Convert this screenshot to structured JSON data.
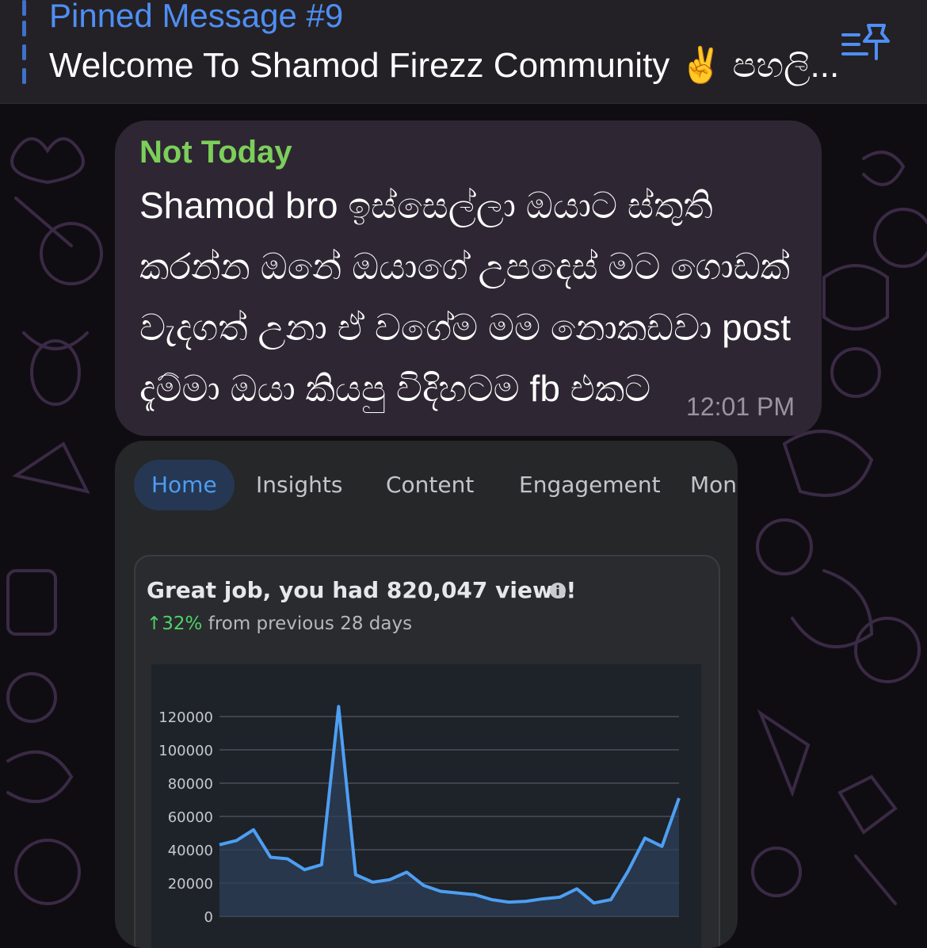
{
  "pinned": {
    "title": "Pinned Message #9",
    "text": "Welcome To Shamod Firezz Community ✌️ පහලි..."
  },
  "message": {
    "sender": "Not Today",
    "lines": [
      "Shamod bro ඉස්සෙල්ලා ඔයාට ස්තුති",
      "කරන්න ඔනේ ඔයාගේ උපදෙස් මට ගොඩක්",
      "වැදගත් උනා ඒ වගේම මම නොකඩවා post",
      "දැම්මා ඔයා කියපු විදිහටම fb එකට"
    ],
    "time": "12:01 PM"
  },
  "attachment": {
    "tabs": [
      "Home",
      "Insights",
      "Content",
      "Engagement",
      "Mon"
    ],
    "active_tab": "Home",
    "card": {
      "title": "Great job, you had 820,047 views!",
      "change": "↑32%",
      "change_suffix": " from previous 28 days"
    }
  },
  "colors": {
    "accent_blue": "#4f8ef5",
    "sender_green": "#7ccf5a",
    "line_blue": "#4d9ff2",
    "up_green": "#4fd26a"
  },
  "chart_data": {
    "type": "area",
    "title": "",
    "xlabel": "",
    "ylabel": "",
    "ylim": [
      0,
      120000
    ],
    "yticks": [
      0,
      20000,
      40000,
      60000,
      80000,
      100000,
      120000
    ],
    "grid": true,
    "series": [
      {
        "values": [
          43000,
          45500,
          52000,
          35500,
          34500,
          28000,
          31000,
          126000,
          25000,
          20500,
          22000,
          26500,
          18500,
          15000,
          14000,
          13000,
          10000,
          8500,
          9000,
          10500,
          11500,
          16500,
          8000,
          10000,
          27000,
          47000,
          42000,
          71000
        ]
      }
    ]
  }
}
